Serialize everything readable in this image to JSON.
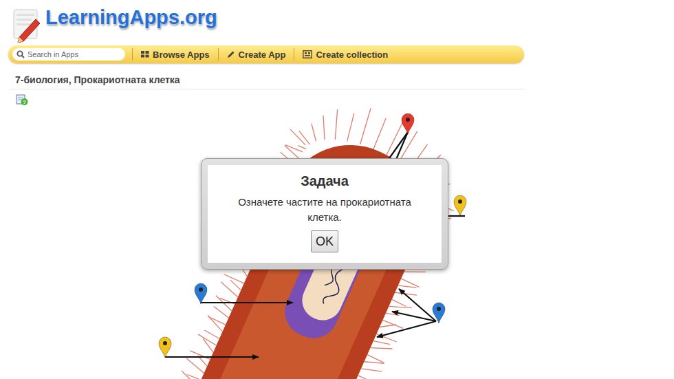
{
  "logo": {
    "text": "LearningApps.org"
  },
  "toolbar": {
    "search": {
      "placeholder": "Search in Apps"
    },
    "items": [
      "Browse Apps",
      "Create App",
      "Create collection"
    ]
  },
  "page": {
    "title": "7-биология, Прокариотната клетка"
  },
  "diagram": {
    "pins": [
      {
        "color": "#e8372c"
      },
      {
        "color": "#f2c21b"
      },
      {
        "color": "#2a7bd6"
      },
      {
        "color": "#2a7bd6"
      },
      {
        "color": "#f2c21b"
      }
    ]
  },
  "dialog": {
    "title": "Задача",
    "message": "Означете частите на прокариотната клетка.",
    "buttons": [
      "OK"
    ]
  }
}
